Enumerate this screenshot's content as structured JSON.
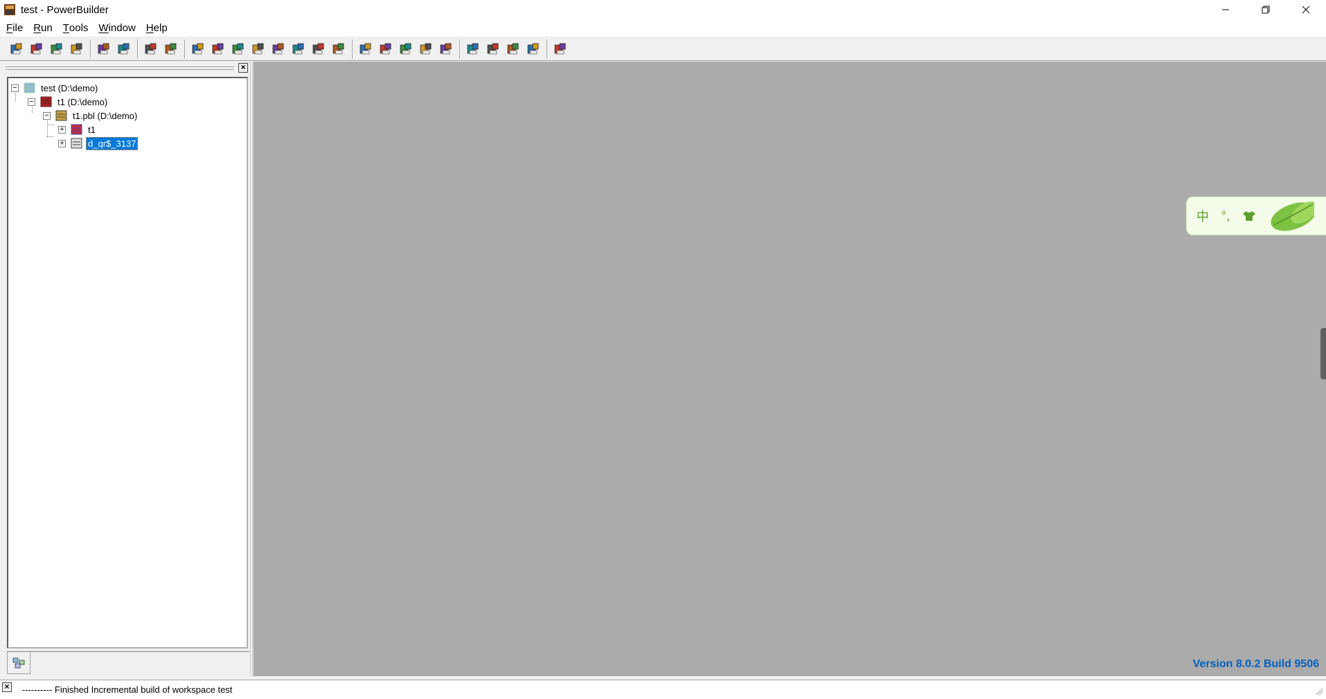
{
  "window": {
    "title": "test - PowerBuilder",
    "icon": "powerbuilder-app-icon"
  },
  "menu": {
    "items": [
      {
        "key": "F",
        "rest": "ile"
      },
      {
        "key": "R",
        "rest": "un"
      },
      {
        "key": "T",
        "rest": "ools"
      },
      {
        "key": "W",
        "rest": "indow"
      },
      {
        "key": "H",
        "rest": "elp"
      }
    ]
  },
  "toolbar": {
    "groups": [
      [
        "new-icon",
        "inherit-icon",
        "open-icon",
        "preview-icon"
      ],
      [
        "layout-icon",
        "layout2-icon"
      ],
      [
        "expand-icon",
        "collapse-icon"
      ],
      [
        "library-painter-icon",
        "application-icon",
        "database-icon",
        "library-icon",
        "dbadmin-icon",
        "pipeline-icon",
        "browser-icon",
        "script-icon"
      ],
      [
        "build-icon",
        "deploy-icon",
        "deploy-all-icon",
        "regen-icon",
        "full-build-icon"
      ],
      [
        "debug-icon",
        "run-icon",
        "select-run-icon",
        "profile-icon"
      ],
      [
        "exit-icon"
      ]
    ]
  },
  "tree": {
    "nodes": [
      {
        "label": "test (D:\\demo)",
        "icon": "workspace-icon",
        "level": 0,
        "expander": "−"
      },
      {
        "label": "t1 (D:\\demo)",
        "icon": "target-icon",
        "level": 1,
        "expander": "−"
      },
      {
        "label": "t1.pbl (D:\\demo)",
        "icon": "pbl-library-icon",
        "level": 2,
        "expander": "−"
      },
      {
        "label": "t1",
        "icon": "application-object-icon",
        "level": 3,
        "expander": "+"
      },
      {
        "label": "d_qr$_3137",
        "icon": "datawindow-icon",
        "level": 3,
        "expander": "+",
        "selected": true
      }
    ]
  },
  "mdi": {
    "version_text": "Version 8.0.2 Build 9506",
    "ime": {
      "mode": "中",
      "punct": "°,",
      "skin": "shirt-icon"
    }
  },
  "output": {
    "message": "---------- Finished Incremental build of workspace test"
  }
}
